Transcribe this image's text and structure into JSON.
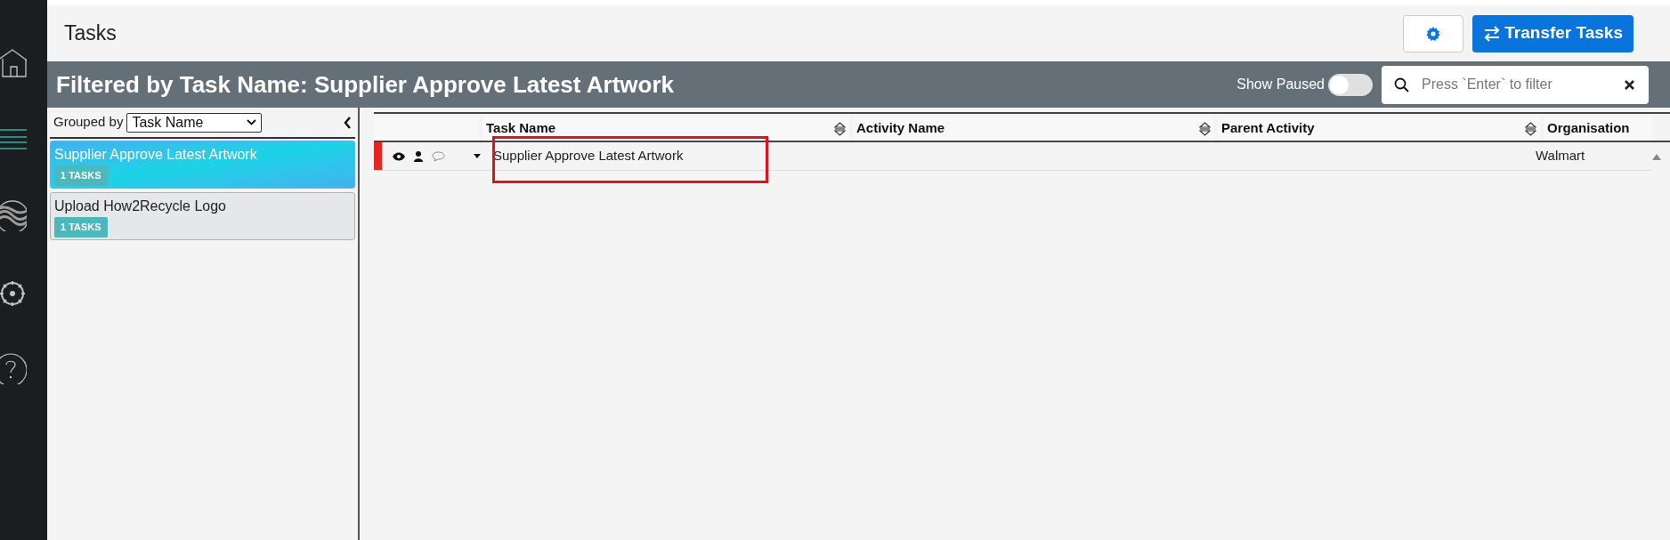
{
  "sidebar": {
    "items": [
      {
        "kind": "home",
        "selected": false
      },
      {
        "kind": "menu",
        "selected": true
      },
      {
        "kind": "waves",
        "selected": false
      },
      {
        "kind": "gear",
        "selected": false
      },
      {
        "kind": "help",
        "selected": false
      }
    ]
  },
  "page": {
    "title": "Tasks",
    "transfer_button": "Transfer Tasks"
  },
  "filter_bar": {
    "title": "Filtered by Task Name: Supplier Approve Latest Artwork",
    "show_paused": {
      "label": "Show Paused",
      "on": false
    },
    "search": {
      "placeholder": "Press `Enter` to filter"
    }
  },
  "groups": {
    "label": "Grouped by",
    "value": "Task Name",
    "items": [
      {
        "name": "Supplier Approve Latest Artwork",
        "count": "1 TASKS",
        "selected": true
      },
      {
        "name": "Upload How2Recycle Logo",
        "count": "1 TASKS",
        "selected": false
      }
    ]
  },
  "table": {
    "columns": [
      "Task Name",
      "Activity Name",
      "Parent Activity",
      "Organisation"
    ],
    "rows": [
      {
        "flagged": true,
        "task_name": "Supplier Approve Latest Artwork",
        "activity_name": "",
        "parent_activity": "",
        "organisation": "Walmart",
        "highlighted": true
      }
    ]
  }
}
